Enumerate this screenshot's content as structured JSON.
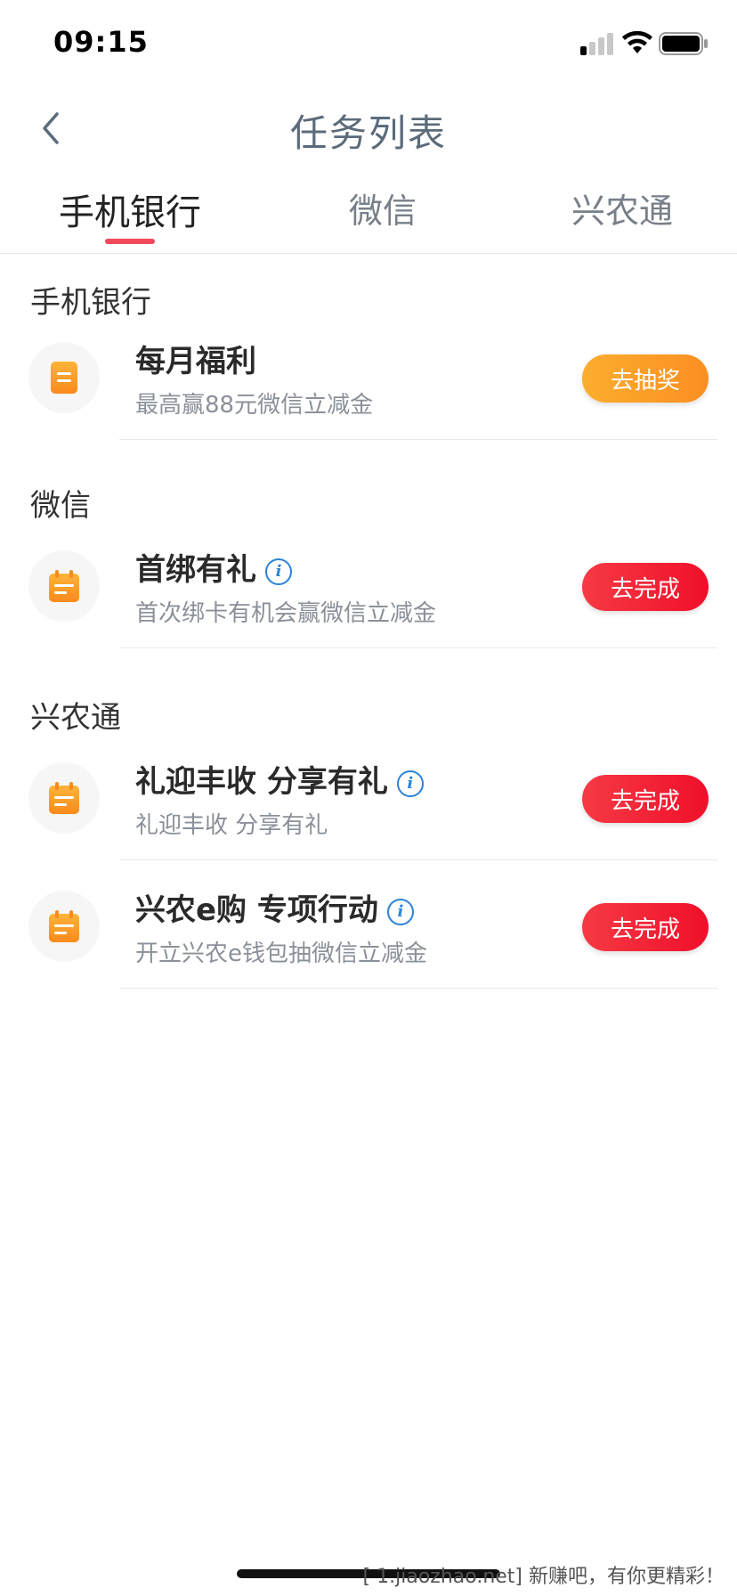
{
  "status_bar": {
    "time": "09:15"
  },
  "nav": {
    "title": "任务列表"
  },
  "tabs": [
    {
      "label": "手机银行",
      "active": true
    },
    {
      "label": "微信",
      "active": false
    },
    {
      "label": "兴农通",
      "active": false
    }
  ],
  "sections": [
    {
      "title": "手机银行",
      "tasks": [
        {
          "icon": "document-icon",
          "title": "每月福利",
          "subtitle": "最高赢88元微信立减金",
          "info": false,
          "button": "去抽奖",
          "button_color": "#fb9b28"
        }
      ]
    },
    {
      "title": "微信",
      "tasks": [
        {
          "icon": "calendar-icon",
          "title": "首绑有礼",
          "subtitle": "首次绑卡有机会赢微信立减金",
          "info": true,
          "button": "去完成",
          "button_color": "#f3213a"
        }
      ]
    },
    {
      "title": "兴农通",
      "tasks": [
        {
          "icon": "calendar-icon",
          "title": "礼迎丰收 分享有礼",
          "subtitle": "礼迎丰收 分享有礼",
          "info": true,
          "button": "去完成",
          "button_color": "#f3213a"
        },
        {
          "icon": "calendar-icon",
          "title": "兴农e购 专项行动",
          "subtitle": "开立兴农e钱包抽微信立减金",
          "info": true,
          "button": "去完成",
          "button_color": "#f3213a"
        }
      ]
    }
  ],
  "info_glyph": "i",
  "watermark": "[ 1.jiaozhao.net] 新赚吧，有你更精彩！"
}
